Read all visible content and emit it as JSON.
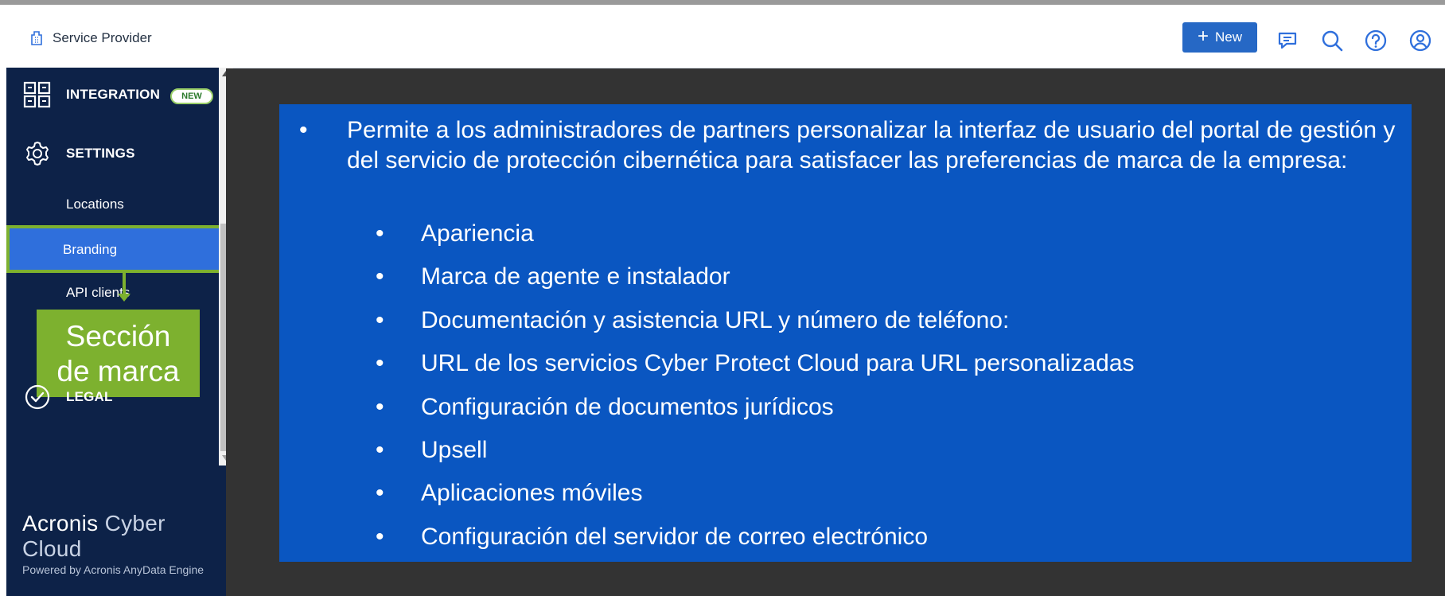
{
  "header": {
    "title": "Service Provider",
    "new_button": "New",
    "icons": [
      "building-icon",
      "chat-icon",
      "search-icon",
      "help-icon",
      "user-icon"
    ]
  },
  "sidebar": {
    "integration": {
      "label": "INTEGRATION",
      "badge": "NEW"
    },
    "settings": {
      "label": "SETTINGS",
      "items": [
        "Locations",
        "Branding",
        "API clients"
      ]
    },
    "legal": {
      "label": "LEGAL"
    },
    "logo_bold": "Acronis",
    "logo_light": "Cyber Cloud",
    "powered": "Powered by Acronis AnyData Engine"
  },
  "callout": {
    "line1": "Sección",
    "line2": "de marca"
  },
  "panel": {
    "intro": "Permite a los administradores de partners personalizar la interfaz de usuario del portal de gestión y del servicio de protección cibernética para satisfacer las preferencias de marca de la empresa:",
    "bullet_char": "•",
    "items": [
      "Apariencia",
      "Marca de agente e instalador",
      "Documentación y asistencia URL y número de teléfono:",
      "URL de los servicios Cyber Protect Cloud para URL personalizadas",
      "Configuración de documentos jurídicos",
      "Upsell",
      "Aplicaciones móviles",
      "Configuración del servidor de correo electrónico"
    ]
  },
  "colors": {
    "sidebar_bg": "#0d2248",
    "selected_bg": "#2f6fdc",
    "highlight_green": "#7db12f",
    "panel_bg": "#0a56c1",
    "main_bg": "#333333",
    "button_blue": "#2668c5"
  }
}
